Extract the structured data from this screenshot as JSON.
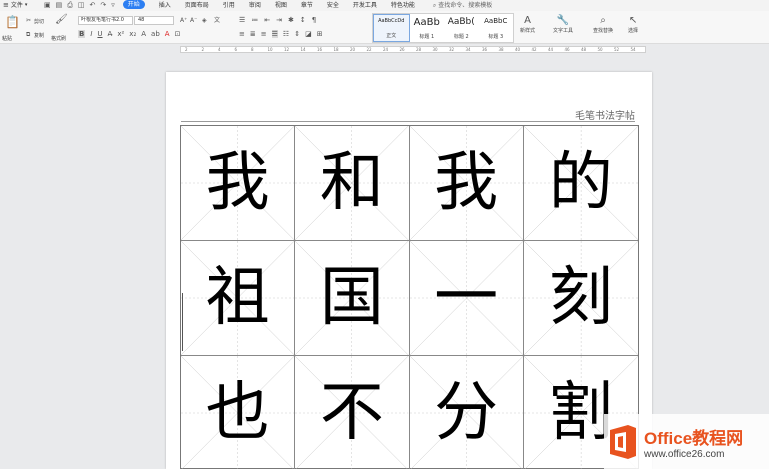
{
  "menubar": {
    "file_label": "文件",
    "tabs": [
      {
        "label": "开始",
        "active": true
      },
      {
        "label": "插入",
        "active": false
      },
      {
        "label": "页面布局",
        "active": false
      },
      {
        "label": "引用",
        "active": false
      },
      {
        "label": "审阅",
        "active": false
      },
      {
        "label": "视图",
        "active": false
      },
      {
        "label": "章节",
        "active": false
      },
      {
        "label": "安全",
        "active": false
      },
      {
        "label": "开发工具",
        "active": false
      },
      {
        "label": "特色功能",
        "active": false
      }
    ],
    "search_label": "查找命令、搜索模板"
  },
  "ribbon": {
    "cut": "剪切",
    "copy": "复制",
    "paste": "粘贴",
    "format_painter": "格式刷",
    "font_name": "叶根友毛笔行书2.0",
    "font_size": "48",
    "styles": [
      {
        "sample": "AaBbCcDd",
        "name": "正文",
        "selected": true,
        "size": 5
      },
      {
        "sample": "AaBb",
        "name": "标题 1",
        "selected": false,
        "size": 10
      },
      {
        "sample": "AaBb(",
        "name": "标题 2",
        "selected": false,
        "size": 9
      },
      {
        "sample": "AaBbC",
        "name": "标题 3",
        "selected": false,
        "size": 7
      }
    ],
    "new_style": "新样式",
    "text_tools": "文字工具",
    "find_replace": "查找替换",
    "select": "选择"
  },
  "ruler_marks": [
    "2",
    "2",
    "4",
    "6",
    "8",
    "10",
    "12",
    "14",
    "16",
    "18",
    "20",
    "22",
    "24",
    "26",
    "28",
    "30",
    "32",
    "34",
    "36",
    "38",
    "40",
    "42",
    "44",
    "46",
    "48",
    "50",
    "52",
    "54"
  ],
  "document": {
    "header_text": "毛笔书法字帖",
    "characters": [
      "我",
      "和",
      "我",
      "的",
      "祖",
      "国",
      "一",
      "刻",
      "也",
      "不",
      "分",
      "割"
    ]
  },
  "watermark": {
    "brand": "Office教程网",
    "url": "www.office26.com"
  },
  "colors": {
    "accent": "#2d7ff2",
    "brand_orange": "#e8531f"
  }
}
